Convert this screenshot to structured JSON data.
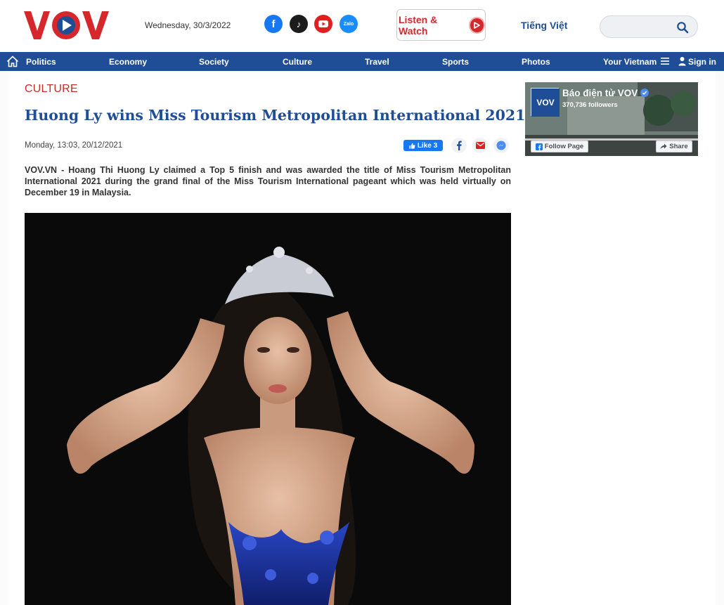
{
  "header": {
    "date": "Wednesday, 30/3/2022",
    "social": [
      "facebook-icon",
      "tiktok-icon",
      "youtube-icon",
      "zalo-icon"
    ],
    "zalo_text": "Zalo",
    "listen_label": "Listen & Watch",
    "language": "Tiếng Việt",
    "search_placeholder": ""
  },
  "nav": {
    "items": [
      "Politics",
      "Economy",
      "Society",
      "Culture",
      "Travel",
      "Sports",
      "Photos",
      "Your Vietnam"
    ],
    "sign_in": "Sign in"
  },
  "article": {
    "category": "CULTURE",
    "title": "Huong Ly wins Miss Tourism Metropolitan International 2021",
    "timestamp": "Monday, 13:03, 20/12/2021",
    "like_label": "Like 3",
    "lead": "VOV.VN - Hoang Thi Huong Ly claimed a Top 5 finish and was awarded the title of Miss Tourism Metropolitan International 2021 during the grand final of the Miss Tourism International pageant which was held virtually on December 19 in Malaysia."
  },
  "fb_widget": {
    "page_name": "Báo điện tử VOV",
    "followers": "370,736 followers",
    "follow_label": "Follow Page",
    "share_label": "Share"
  },
  "colors": {
    "brand_red": "#d6282c",
    "brand_blue": "#1f4e96",
    "category_red": "#c4302b"
  }
}
